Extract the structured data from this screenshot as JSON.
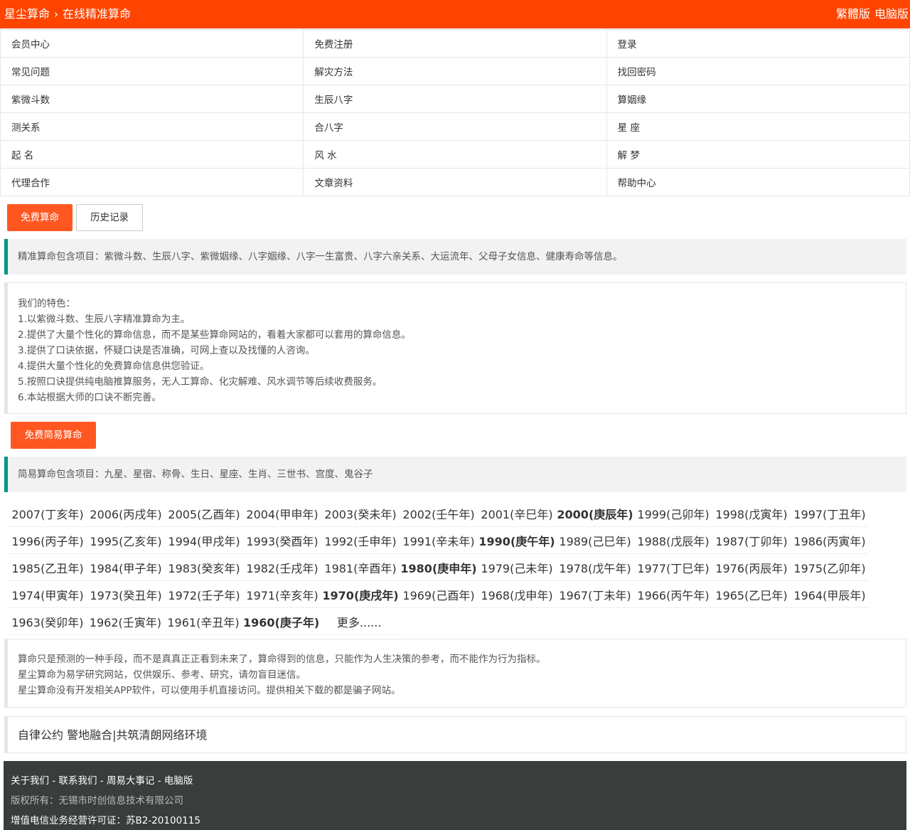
{
  "header": {
    "site": "星尘算命",
    "separator": "›",
    "page": "在线精准算命",
    "traditional": "繁體版",
    "desktop": "电脑版"
  },
  "nav": [
    [
      "会员中心",
      "免费注册",
      "登录"
    ],
    [
      "常见问题",
      "解灾方法",
      "找回密码"
    ],
    [
      "紫微斗数",
      "生辰八字",
      "算姻缘"
    ],
    [
      "测关系",
      "合八字",
      "星 座"
    ],
    [
      "起 名",
      "风 水",
      "解 梦"
    ],
    [
      "代理合作",
      "文章资料",
      "帮助中心"
    ]
  ],
  "tabs": {
    "free": "免费算命",
    "history": "历史记录"
  },
  "precise_items": "精准算命包含项目：紫微斗数、生辰八字、紫微姻缘、八字姻缘、八字一生富贵、八字六亲关系、大运流年、父母子女信息、健康寿命等信息。",
  "features": [
    "我们的特色：",
    "1.以紫微斗数、生辰八字精准算命为主。",
    "2.提供了大量个性化的算命信息，而不是某些算命网站的，看着大家都可以套用的算命信息。",
    "3.提供了口诀依据，怀疑口诀是否准确，可网上查以及找懂的人咨询。",
    "4.提供大量个性化的免费算命信息供您验证。",
    "5.按照口诀提供纯电脑推算服务，无人工算命、化灾解难、风水调节等后续收费服务。",
    "6.本站根据大师的口诀不断完善。"
  ],
  "simple_button": "免费简易算命",
  "simple_items": "简易算命包含项目：九星、星宿、称骨、生日、星座、生肖、三世书、宫度、鬼谷子",
  "years": [
    [
      "2007(丁亥年)",
      "2006(丙戌年)",
      "2005(乙酉年)",
      "2004(甲申年)",
      "2003(癸未年)",
      "2002(壬午年)",
      "2001(辛巳年)",
      "2000(庚辰年)",
      "1999(己卯年)",
      "1998(戊寅年)",
      "1997(丁丑年)"
    ],
    [
      "1996(丙子年)",
      "1995(乙亥年)",
      "1994(甲戌年)",
      "1993(癸酉年)",
      "1992(壬申年)",
      "1991(辛未年)",
      "1990(庚午年)",
      "1989(己巳年)",
      "1988(戊辰年)",
      "1987(丁卯年)",
      "1986(丙寅年)"
    ],
    [
      "1985(乙丑年)",
      "1984(甲子年)",
      "1983(癸亥年)",
      "1982(壬戌年)",
      "1981(辛酉年)",
      "1980(庚申年)",
      "1979(己未年)",
      "1978(戊午年)",
      "1977(丁巳年)",
      "1976(丙辰年)",
      "1975(乙卯年)"
    ],
    [
      "1974(甲寅年)",
      "1973(癸丑年)",
      "1972(壬子年)",
      "1971(辛亥年)",
      "1970(庚戌年)",
      "1969(己酉年)",
      "1968(戊申年)",
      "1967(丁未年)",
      "1966(丙午年)",
      "1965(乙巳年)",
      "1964(甲辰年)"
    ],
    [
      "1963(癸卯年)",
      "1962(壬寅年)",
      "1961(辛丑年)",
      "1960(庚子年)",
      "更多......"
    ]
  ],
  "bold_years": [
    "2000(庚辰年)",
    "1990(庚午年)",
    "1980(庚申年)",
    "1970(庚戌年)",
    "1960(庚子年)"
  ],
  "disclaimer": [
    "算命只是预测的一种手段，而不是真真正正看到未来了，算命得到的信息，只能作为人生决策的参考，而不能作为行为指标。",
    "星尘算命为易学研究网站，仅供娱乐、参考、研究，请勿盲目迷信。",
    "星尘算命没有开发相关APP软件，可以使用手机直接访问。提供相关下载的都是骗子网站。"
  ],
  "pledge": "自律公约 警地融合|共筑清朗网络环境",
  "footer": {
    "links": [
      "关于我们",
      "联系我们",
      "周易大事记",
      "电脑版"
    ],
    "link_sep": " - ",
    "copyright": "版权所有：无锡市时创信息技术有限公司",
    "license": "增值电信业务经营许可证：苏B2-20100115"
  },
  "colors": {
    "brand": "#ff4400",
    "button": "#ff5722",
    "quote_border": "#009688",
    "footer_bg": "#393d3c"
  }
}
